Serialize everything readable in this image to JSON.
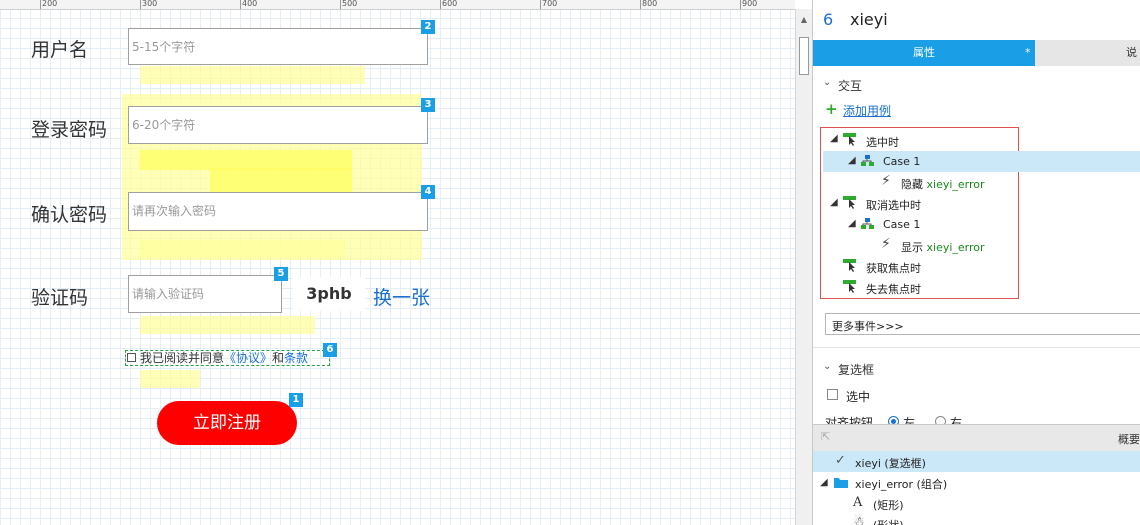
{
  "ruler": {
    "ticks": [
      "200",
      "300",
      "400",
      "500",
      "600",
      "700",
      "800",
      "900"
    ]
  },
  "form": {
    "username": {
      "label": "用户名",
      "placeholder": "5-15个字符",
      "badge": "2"
    },
    "password": {
      "label": "登录密码",
      "placeholder": "6-20个字符",
      "badge": "3"
    },
    "confirm": {
      "label": "确认密码",
      "placeholder": "请再次输入密码",
      "badge": "4"
    },
    "captcha": {
      "label": "验证码",
      "placeholder": "请输入验证码",
      "badge": "5",
      "code": "3phb",
      "refresh": "换一张"
    },
    "agree": {
      "prefix": "我已阅读并同意",
      "link1": "《协议》",
      "and": "和",
      "link2": "条款",
      "badge": "6"
    },
    "submit": {
      "label": "立即注册",
      "badge": "1"
    }
  },
  "panel": {
    "header": {
      "id": "6",
      "name": "xieyi"
    },
    "tabs": {
      "properties": "属性",
      "properties_mark": "*",
      "other": "说"
    },
    "interaction": {
      "title": "交互",
      "add_case": "添加用例",
      "events": [
        {
          "label": "选中时"
        },
        {
          "label": "Case 1"
        },
        {
          "action": "隐藏",
          "target": "xieyi_error"
        },
        {
          "label": "取消选中时"
        },
        {
          "label": "Case 1"
        },
        {
          "action": "显示",
          "target": "xieyi_error"
        },
        {
          "label": "获取焦点时"
        },
        {
          "label": "失去焦点时"
        }
      ],
      "more_events": "更多事件>>>"
    },
    "checkbox_section": {
      "title": "复选框",
      "selected_label": "选中",
      "align_label": "对齐按钮",
      "left": "左",
      "right": "右"
    },
    "outline": {
      "title": "概要",
      "items": [
        {
          "text": "xieyi (复选框)"
        },
        {
          "text": "xieyi_error (组合)"
        },
        {
          "text": "(矩形)"
        },
        {
          "text": "(形状)"
        }
      ]
    }
  }
}
